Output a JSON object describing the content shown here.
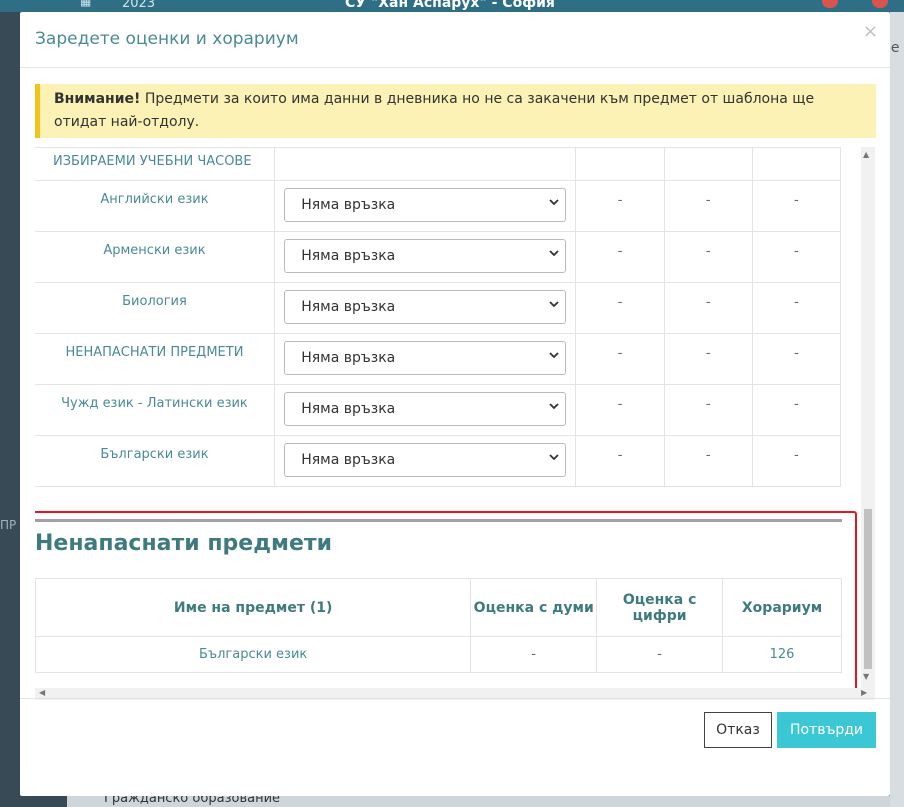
{
  "background": {
    "year": "2023",
    "school": "СУ \"Хан Аспарух\" - София",
    "sidebar_fragment": "ПР",
    "right_fragment": "ре",
    "bottom_item": "Гражданско образование"
  },
  "modal": {
    "title": "Заредете оценки и хорариум",
    "close_icon": "×"
  },
  "alert": {
    "strong": "Внимание!",
    "text": " Предмети за които има данни в дневника но не са закачени към предмет от шаблона ще отидат най-отдолу."
  },
  "mapping": {
    "group_header": "ИЗБИРАЕМИ УЧЕБНИ ЧАСОВЕ",
    "rows": [
      {
        "name": "Английски език",
        "select": "Няма връзка",
        "d1": "-",
        "d2": "-",
        "d3": "-"
      },
      {
        "name": "Арменски език",
        "select": "Няма връзка",
        "d1": "-",
        "d2": "-",
        "d3": "-"
      },
      {
        "name": "Биология",
        "select": "Няма връзка",
        "d1": "-",
        "d2": "-",
        "d3": "-"
      },
      {
        "name": "НЕНАПАСНАТИ ПРЕДМЕТИ",
        "select": "Няма връзка",
        "d1": "-",
        "d2": "-",
        "d3": "-"
      },
      {
        "name": "Чужд език - Латински език",
        "select": "Няма връзка",
        "d1": "-",
        "d2": "-",
        "d3": "-"
      },
      {
        "name": "Български език",
        "select": "Няма връзка",
        "d1": "-",
        "d2": "-",
        "d3": "-"
      }
    ]
  },
  "unmatched": {
    "title": "Ненапаснати предмети",
    "headers": {
      "name": "Име на предмет (1)",
      "grade_words": "Оценка с думи",
      "grade_digits": "Оценка с цифри",
      "hours": "Хорариум"
    },
    "rows": [
      {
        "name": "Български език",
        "grade_words": "-",
        "grade_digits": "-",
        "hours": "126"
      }
    ]
  },
  "footer": {
    "cancel": "Отказ",
    "confirm": "Потвърди"
  },
  "colors": {
    "accent": "#4a8a97",
    "confirm": "#3bc7d4",
    "alert_bg": "#fcf2b6",
    "alert_border": "#f0c419",
    "highlight": "#e8161c"
  }
}
